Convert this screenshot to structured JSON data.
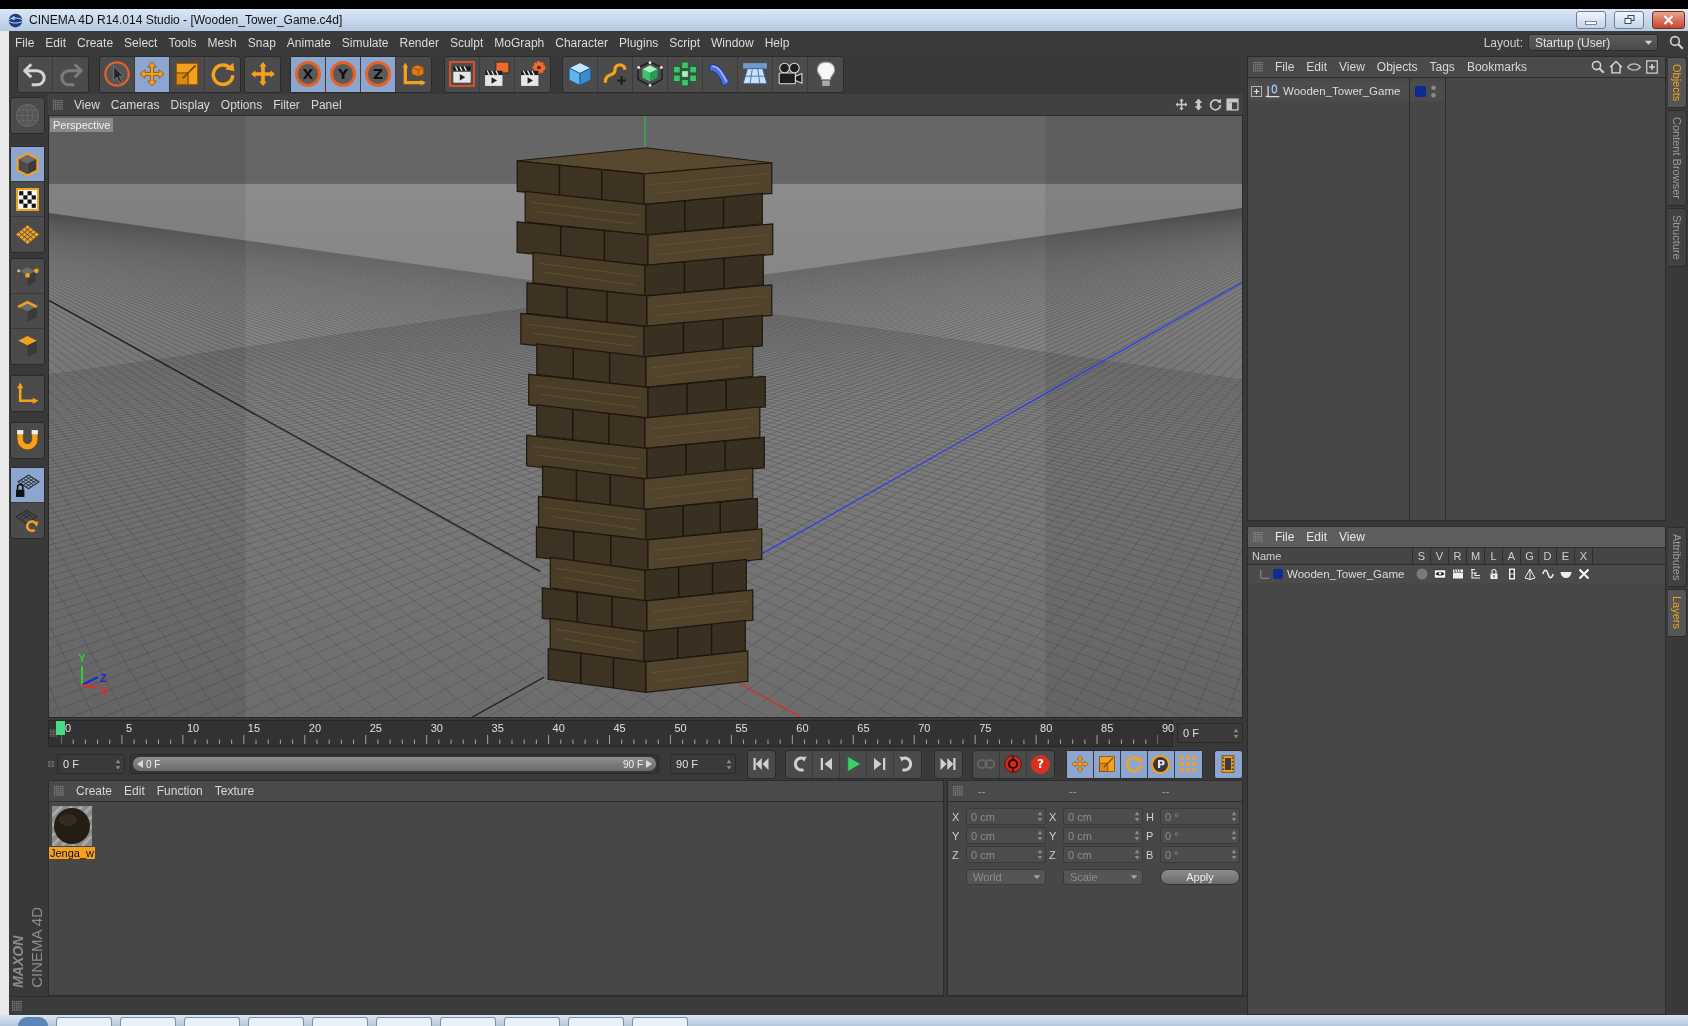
{
  "window": {
    "title": "CINEMA 4D R14.014 Studio - [Wooden_Tower_Game.c4d]"
  },
  "menu": [
    "File",
    "Edit",
    "Create",
    "Select",
    "Tools",
    "Mesh",
    "Snap",
    "Animate",
    "Simulate",
    "Render",
    "Sculpt",
    "MoGraph",
    "Character",
    "Plugins",
    "Script",
    "Window",
    "Help"
  ],
  "layout": {
    "label": "Layout:",
    "value": "Startup (User)"
  },
  "toolbar": [
    {
      "buttons": [
        {
          "selected": false,
          "disabled": false
        },
        {
          "selected": false,
          "disabled": true
        }
      ]
    },
    {
      "buttons": [
        {
          "selected": false,
          "disabled": false
        },
        {
          "selected": true,
          "disabled": false
        },
        {
          "selected": false,
          "disabled": false
        },
        {
          "selected": false,
          "disabled": false
        }
      ]
    },
    {
      "buttons": [
        {
          "selected": false,
          "disabled": false
        }
      ]
    },
    {
      "buttons": [
        {
          "label": "X",
          "selected": true,
          "disabled": false
        },
        {
          "label": "Y",
          "selected": true,
          "disabled": false
        },
        {
          "label": "Z",
          "selected": true,
          "disabled": false
        },
        {
          "selected": false,
          "disabled": false
        }
      ]
    },
    {
      "buttons": [
        {
          "selected": false,
          "disabled": false
        },
        {
          "selected": false,
          "disabled": false
        },
        {
          "selected": false,
          "disabled": false
        }
      ]
    },
    {
      "buttons": [
        {
          "selected": false,
          "disabled": false
        },
        {
          "selected": false,
          "disabled": false
        },
        {
          "selected": false,
          "disabled": false
        },
        {
          "selected": false,
          "disabled": false
        },
        {
          "selected": false,
          "disabled": false
        },
        {
          "selected": false,
          "disabled": false
        },
        {
          "selected": false,
          "disabled": false
        },
        {
          "selected": false,
          "disabled": false
        }
      ]
    }
  ],
  "tool_palette": [
    {
      "buttons": [
        {
          "selected": false,
          "disabled": true
        }
      ]
    },
    {
      "buttons": [
        {
          "selected": true,
          "disabled": false
        },
        {
          "selected": false,
          "disabled": false
        },
        {
          "selected": false,
          "disabled": false
        }
      ]
    },
    {
      "buttons": [
        {
          "selected": false,
          "disabled": false
        },
        {
          "selected": false,
          "disabled": false
        },
        {
          "selected": false,
          "disabled": false
        }
      ]
    },
    {
      "buttons": [
        {
          "selected": false,
          "disabled": false
        }
      ]
    },
    {
      "buttons": [
        {
          "selected": false,
          "disabled": false
        }
      ]
    },
    {
      "buttons": [
        {
          "selected": true,
          "disabled": false
        },
        {
          "selected": false,
          "disabled": false
        }
      ]
    }
  ],
  "brand": {
    "wordmark": "MAXON",
    "product": "CINEMA 4D"
  },
  "viewport": {
    "menu": [
      "View",
      "Cameras",
      "Display",
      "Options",
      "Filter",
      "Panel"
    ],
    "camera": "Perspective",
    "axes": [
      {
        "label": "Y",
        "color": "#30d030"
      },
      {
        "label": "Z",
        "color": "#1c28d8"
      },
      {
        "label": "X",
        "color": "#e82a2a"
      }
    ]
  },
  "timeline": {
    "labels": [
      "0",
      "5",
      "10",
      "15",
      "20",
      "25",
      "30",
      "35",
      "40",
      "45",
      "50",
      "55",
      "60",
      "65",
      "70",
      "75",
      "80",
      "85",
      "90"
    ],
    "playhead": {
      "level": 0
    },
    "frame": "0 F"
  },
  "transport": {
    "start": "0 F",
    "range": {
      "start": "0 F",
      "end": "90 F",
      "level": 1
    },
    "end": "90 F",
    "groups": [
      {
        "buttons": [
          {
            "selected": false,
            "disabled": false
          }
        ]
      },
      {
        "buttons": [
          {
            "selected": false,
            "disabled": false
          },
          {
            "selected": false,
            "disabled": false
          },
          {
            "selected": false,
            "disabled": false
          },
          {
            "selected": false,
            "disabled": false
          },
          {
            "selected": false,
            "disabled": false
          }
        ]
      },
      {
        "buttons": [
          {
            "selected": false,
            "disabled": false
          }
        ]
      },
      {
        "buttons": [
          {
            "selected": false,
            "disabled": true
          },
          {
            "selected": false,
            "disabled": false
          },
          {
            "label": "?",
            "selected": false,
            "disabled": false
          }
        ]
      },
      {
        "buttons": [
          {
            "selected": true,
            "disabled": false
          },
          {
            "selected": true,
            "disabled": false
          },
          {
            "selected": true,
            "disabled": false
          },
          {
            "label": "P",
            "selected": true,
            "disabled": false
          },
          {
            "selected": true,
            "disabled": false
          }
        ]
      },
      {
        "buttons": [
          {
            "selected": true,
            "disabled": false
          }
        ]
      }
    ]
  },
  "materials": {
    "menu": [
      "Create",
      "Edit",
      "Function",
      "Texture"
    ],
    "items": [
      {
        "name": "Jenga_w",
        "selected": true
      }
    ]
  },
  "coordinates": {
    "headers": [
      "--",
      "--",
      "--"
    ],
    "rows": [
      {
        "cells": [
          {
            "axis": "X",
            "value": "0 cm",
            "disabled": true
          },
          {
            "axis": "X",
            "value": "0 cm",
            "disabled": true
          },
          {
            "axis": "H",
            "value": "0 °",
            "disabled": true
          }
        ]
      },
      {
        "cells": [
          {
            "axis": "Y",
            "value": "0 cm",
            "disabled": true
          },
          {
            "axis": "Y",
            "value": "0 cm",
            "disabled": true
          },
          {
            "axis": "P",
            "value": "0 °",
            "disabled": true
          }
        ]
      },
      {
        "cells": [
          {
            "axis": "Z",
            "value": "0 cm",
            "disabled": true
          },
          {
            "axis": "Z",
            "value": "0 cm",
            "disabled": true
          },
          {
            "axis": "B",
            "value": "0 °",
            "disabled": true
          }
        ]
      }
    ],
    "dropdowns": [
      {
        "value": "World",
        "disabled": true
      },
      {
        "value": "Scale",
        "disabled": true
      }
    ],
    "apply": "Apply"
  },
  "objects": {
    "menu": [
      "File",
      "Edit",
      "View",
      "Objects",
      "Tags",
      "Bookmarks"
    ],
    "items": [
      {
        "name": "Wooden_Tower_Game",
        "expanded": false,
        "color": "#0f2a94"
      }
    ]
  },
  "object_tabs": [
    {
      "label": "Objects",
      "selected": true
    },
    {
      "label": "Content Browser",
      "selected": false
    },
    {
      "label": "Structure",
      "selected": false
    }
  ],
  "layers": {
    "menu": [
      "File",
      "Edit",
      "View"
    ],
    "columns": [
      "Name",
      "S",
      "V",
      "R",
      "M",
      "L",
      "A",
      "G",
      "D",
      "E",
      "X"
    ],
    "items": [
      {
        "name": "Wooden_Tower_Game",
        "color": "#0f2a94"
      }
    ]
  },
  "layer_tabs": [
    {
      "label": "Attributes",
      "selected": false
    },
    {
      "label": "Layers",
      "selected": true
    }
  ]
}
